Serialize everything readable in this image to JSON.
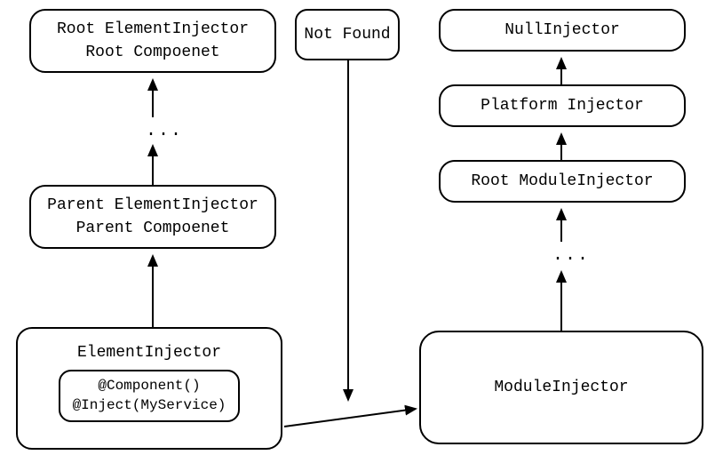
{
  "diagram": {
    "left": {
      "root": {
        "line1": "Root ElementInjector",
        "line2": "Root Compoenet"
      },
      "ellipsis": "...",
      "parent": {
        "line1": "Parent ElementInjector",
        "line2": "Parent Compoenet"
      },
      "element": {
        "title": "ElementInjector",
        "inner": {
          "line1": "@Component()",
          "line2": "@Inject(MyService)"
        }
      }
    },
    "middle": {
      "notFound": "Not Found"
    },
    "right": {
      "null": "NullInjector",
      "platform": "Platform Injector",
      "rootModule": "Root ModuleInjector",
      "ellipsis": "...",
      "module": "ModuleInjector"
    }
  }
}
